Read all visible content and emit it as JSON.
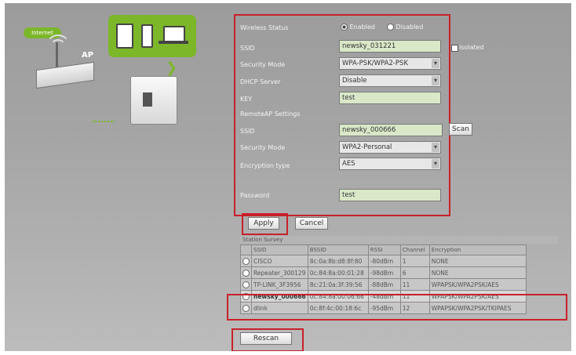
{
  "illustration": {
    "internet_label": "Internet",
    "ap_label": "AP"
  },
  "form": {
    "wireless_status": {
      "label": "Wireless Status",
      "enabled": "Enabled",
      "disabled": "Disabled"
    },
    "ssid": {
      "label": "SSID",
      "value": "newsky_031221"
    },
    "isolated_label": "Isolated",
    "security_mode": {
      "label": "Security Mode",
      "value": "WPA-PSK/WPA2-PSK"
    },
    "dhcp_server": {
      "label": "DHCP Server",
      "value": "Disable"
    },
    "key": {
      "label": "KEY",
      "value": "test"
    },
    "remote_ap_settings": "RemoteAP Settings",
    "remote_ssid": {
      "label": "SSID",
      "value": "newsky_000666"
    },
    "scan_button": "Scan",
    "remote_security_mode": {
      "label": "Security Mode",
      "value": "WPA2-Personal"
    },
    "encryption_type": {
      "label": "Encryption type",
      "value": "AES"
    },
    "password": {
      "label": "Password",
      "value": "test"
    }
  },
  "buttons": {
    "apply": "Apply",
    "cancel": "Cancel",
    "rescan": "Rescan"
  },
  "survey": {
    "title": "Station Survey",
    "columns": [
      "SSID",
      "BSSID",
      "RSSI",
      "Channel",
      "Encryption"
    ],
    "rows": [
      {
        "ssid": "CISCO",
        "bssid": "8c:0a:8b:d8:8f:80",
        "rssi": "-80dBm",
        "channel": "1",
        "encryption": "NONE"
      },
      {
        "ssid": "Repeater_300129",
        "bssid": "0c:84:8a:00:01:28",
        "rssi": "-98dBm",
        "channel": "6",
        "encryption": "NONE"
      },
      {
        "ssid": "TP-LINK_3F3956",
        "bssid": "8c:21:0a:3f:39:56",
        "rssi": "-88dBm",
        "channel": "11",
        "encryption": "WPAPSK/WPA2PSK/AES"
      },
      {
        "ssid": "newsky_000666",
        "bssid": "0c:84:8a:00:06:66",
        "rssi": "-48dBm",
        "channel": "11",
        "encryption": "WPAPSK/WPA2PSK/AES"
      },
      {
        "ssid": "dlink",
        "bssid": "0c:8f:4c:00:18:6c",
        "rssi": "-95dBm",
        "channel": "12",
        "encryption": "WPAPSK/WPA2PSK/TKIPAES"
      }
    ]
  }
}
